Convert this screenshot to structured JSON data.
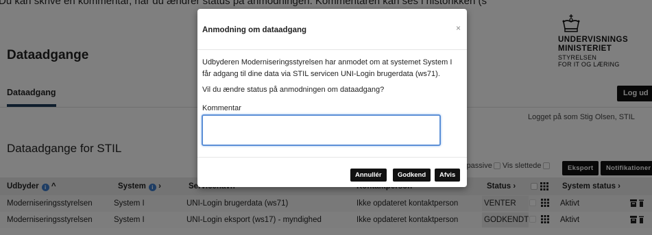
{
  "caption": "Du kan skrive en kommentar, når du ændrer status på anmodningen. Kommentaren kan ses i historikken (s",
  "page": {
    "title": "Dataadgange",
    "section_title": "Dataadgange for STIL",
    "logged_in": "Logget på som Stig Olsen, STIL"
  },
  "logo": {
    "line1": "UNDERVISNINGS",
    "line2": "MINISTERIET",
    "line3": "STYRELSEN",
    "line4": "FOR IT OG LÆRING"
  },
  "nav": {
    "tab": "Dataadgang",
    "logout": "Log ud"
  },
  "filters": {
    "show_passive": "s passive",
    "show_deleted": "Vis slettede",
    "export": "Eksport",
    "notifications": "Notifikationer"
  },
  "table": {
    "headers": {
      "provider": "Udbyder",
      "system": "System",
      "service": "Servicenavn",
      "contact": "Kontaktperson",
      "status": "Status",
      "system_status": "System status"
    },
    "rows": [
      {
        "provider": "Moderniseringsstyrelsen",
        "system": "System I",
        "service": "UNI-Login brugerdata (ws71)",
        "contact": "Ikke opdateret kontaktperson",
        "status": "VENTER",
        "system_status": "Aktivt"
      },
      {
        "provider": "Moderniseringsstyrelsen",
        "system": "System I",
        "service": "UNI-Login eksport (ws17) - myndighed",
        "contact": "Ikke opdateret kontaktperson",
        "status": "GODKENDT",
        "system_status": "Aktivt"
      }
    ]
  },
  "modal": {
    "title": "Anmodning om dataadgang",
    "close": "×",
    "paragraph1": "Udbyderen Moderniseringsstyrelsen har anmodet om at systemet System I får adgang til dine data via STIL servicen UNI-Login brugerdata (ws71).",
    "paragraph2": "Vil du ændre status på anmodningen om dataadgang?",
    "comment_label": "Kommentar",
    "comment_value": "",
    "cancel": "Annullér",
    "approve": "Godkend",
    "reject": "Afvis"
  },
  "colors": {
    "accent": "#1f3c5a",
    "info": "#3d7ac9",
    "focus": "#5b8fd6"
  }
}
